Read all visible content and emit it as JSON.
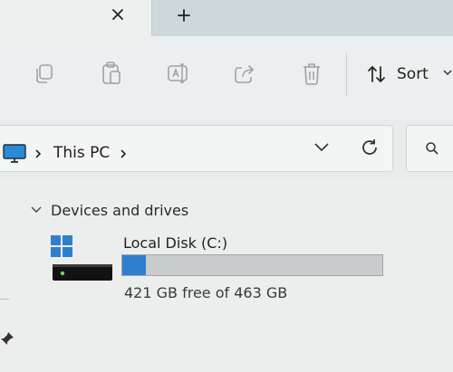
{
  "tabbar": {
    "close_glyph": "✕",
    "new_tab_glyph": "+"
  },
  "toolbar": {
    "icons": [
      "copy-icon",
      "paste-icon",
      "rename-icon",
      "share-icon",
      "delete-icon"
    ],
    "sort_label": "Sort"
  },
  "address": {
    "location": "This PC"
  },
  "group": {
    "label": "Devices and drives"
  },
  "drive": {
    "name": "Local Disk (C:)",
    "space_text": "421 GB free of 463 GB",
    "used_fraction": 0.09
  },
  "colors": {
    "accent": "#2f7fd0",
    "tabstrip": "#cdd7dc"
  }
}
